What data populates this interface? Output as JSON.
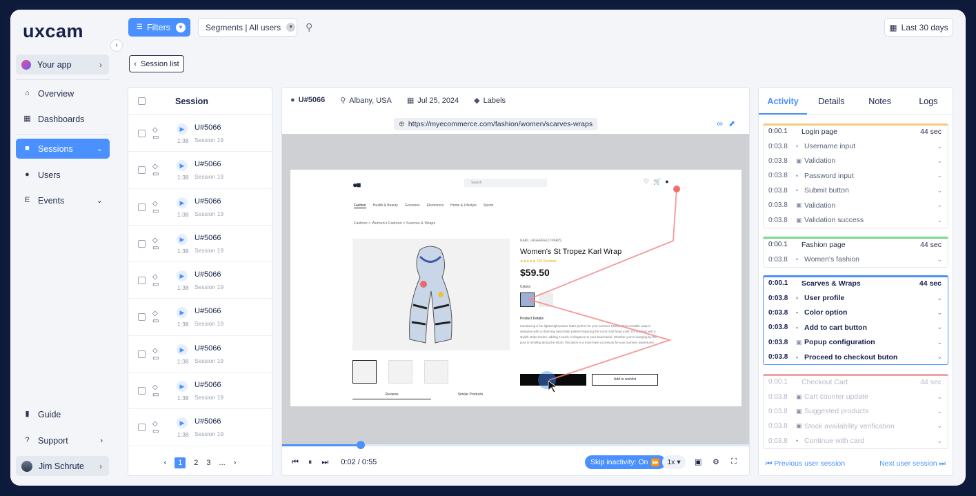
{
  "sidebar": {
    "logo": "uxcam",
    "app_label": "Your app",
    "items": [
      {
        "label": "Overview"
      },
      {
        "label": "Dashboards"
      },
      {
        "label": "Sessions"
      },
      {
        "label": "Users"
      },
      {
        "label": "Events"
      }
    ],
    "bottom_items": [
      {
        "label": "Guide"
      },
      {
        "label": "Support"
      }
    ],
    "user_name": "Jim Schrute"
  },
  "topbar": {
    "filters_label": "Filters",
    "segments_label": "Segments | All users",
    "date_range": "Last 30 days",
    "back_label": "Session list"
  },
  "session_list": {
    "header": "Session",
    "rows": [
      {
        "user": "U#5066",
        "duration": "1:38",
        "session": "Session 19"
      },
      {
        "user": "U#5066",
        "duration": "1:38",
        "session": "Session 19"
      },
      {
        "user": "U#5066",
        "duration": "1:38",
        "session": "Session 19"
      },
      {
        "user": "U#5066",
        "duration": "1:38",
        "session": "Session 19"
      },
      {
        "user": "U#5066",
        "duration": "1:38",
        "session": "Session 19"
      },
      {
        "user": "U#5066",
        "duration": "1:38",
        "session": "Session 19"
      },
      {
        "user": "U#5066",
        "duration": "1:38",
        "session": "Session 19"
      },
      {
        "user": "U#5066",
        "duration": "1:38",
        "session": "Session 19"
      },
      {
        "user": "U#5066",
        "duration": "1:38",
        "session": "Session 19"
      }
    ],
    "pagination": {
      "pages": [
        "1",
        "2",
        "3"
      ],
      "current": "1",
      "ellipsis": "..."
    }
  },
  "player": {
    "user": "U#5066",
    "location": "Albany, USA",
    "date": "Jul 25, 2024",
    "labels": "Labels",
    "url": "https://myecommerce.com/fashion/women/scarves-wraps",
    "time": "0:02 / 0:55",
    "progress": 0.036,
    "skip_label": "Skip inactivity: On",
    "speed": "1x"
  },
  "recorded_page": {
    "search_placeholder": "Search",
    "nav": [
      "Fashion",
      "Health & Beauty",
      "Groceries",
      "Electronics",
      "Home & Lifestyle",
      "Sports"
    ],
    "breadcrumb": "Fashion  >  Women's Fashion  >  Scarves & Wraps",
    "brand": "KARL LAGERFELD PARIS",
    "product_name": "Women's St Tropez Karl Wrap",
    "rating": "★★★★★  120 Reviews",
    "price": "$59.50",
    "colors_label": "Colors:",
    "details_label": "Product Details",
    "details_text": "Introducing a fun lightweight power that's perfect for your summer travels. This versatile wrap is designed with a charming beachside pattern featuring the iconic Karl head motif. It's finished with a stylish stripe border, adding a touch of elegance to your beachwear. Whether you're lounging by the pool or strolling along the shore, this piece is a must-have accessory for your summer adventures.",
    "wishlist_label": "Add to wishlist",
    "tabs": [
      "Reviews",
      "Similar Products"
    ]
  },
  "activity": {
    "tabs": [
      "Activity",
      "Details",
      "Notes",
      "Logs"
    ],
    "groups": [
      {
        "time": "0:00.1",
        "title": "Login page",
        "duration": "44 sec",
        "color": "#f5c97a",
        "events": [
          {
            "time": "0:03.8",
            "label": "Username input",
            "kind": "dot"
          },
          {
            "time": "0:03.8",
            "label": "Validation",
            "kind": "box"
          },
          {
            "time": "0:03.8",
            "label": "Password input",
            "kind": "dot"
          },
          {
            "time": "0:03.8",
            "label": "Submit button",
            "kind": "dot"
          },
          {
            "time": "0:03.8",
            "label": "Validation",
            "kind": "box"
          },
          {
            "time": "0:03.8",
            "label": "Validation success",
            "kind": "box"
          }
        ]
      },
      {
        "time": "0:00.1",
        "title": "Fashion page",
        "duration": "44 sec",
        "color": "#7bd88f",
        "events": [
          {
            "time": "0:03.8",
            "label": "Women's fashion",
            "kind": "dot"
          }
        ]
      },
      {
        "time": "0:00.1",
        "title": "Scarves & Wraps",
        "duration": "44 sec",
        "color": "#4a90ff",
        "events": [
          {
            "time": "0:03.8",
            "label": "User profile",
            "kind": "dot"
          },
          {
            "time": "0:03.8",
            "label": "Color option",
            "kind": "dot"
          },
          {
            "time": "0:03.8",
            "label": "Add to cart button",
            "kind": "dot"
          },
          {
            "time": "0:03.8",
            "label": "Popup configuration",
            "kind": "box"
          },
          {
            "time": "0:03.8",
            "label": "Proceed to checkout buton",
            "kind": "dot"
          }
        ]
      },
      {
        "time": "0:00.1",
        "title": "Checkout Cart",
        "duration": "44 sec",
        "color": "#f0a2a2",
        "events": [
          {
            "time": "0:03.8",
            "label": "Cart counter update",
            "kind": "box"
          },
          {
            "time": "0:03.8",
            "label": "Suggested products",
            "kind": "box"
          },
          {
            "time": "0:03.8",
            "label": "Stock availability verification",
            "kind": "box"
          },
          {
            "time": "0:03.8",
            "label": "Continue with card",
            "kind": "dot"
          }
        ]
      }
    ],
    "prev_label": "Previous user session",
    "next_label": "Next user session"
  }
}
